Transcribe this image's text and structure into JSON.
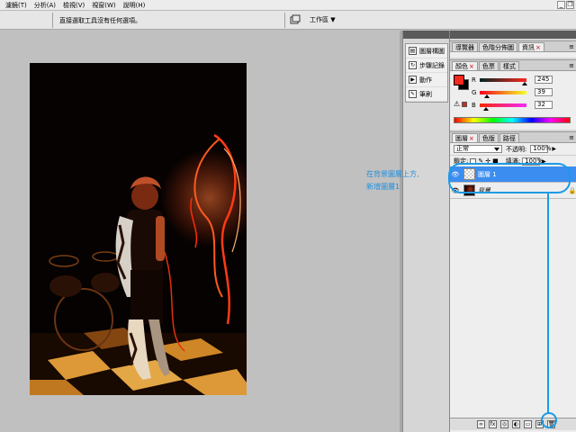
{
  "menubar": {
    "items": [
      "濾鏡(T)",
      "分析(A)",
      "檢視(V)",
      "視窗(W)",
      "說明(H)"
    ],
    "window_controls": [
      "_",
      "❐"
    ]
  },
  "optbar": {
    "message": "直接選取工具沒有任何選項。",
    "workspace_label": "工作區 ▼"
  },
  "mid_dock": {
    "items": [
      {
        "label": "圖層構圖",
        "icon": "layer-comps-icon"
      },
      {
        "label": "步驟記錄",
        "icon": "history-icon"
      },
      {
        "label": "動作",
        "icon": "actions-icon"
      },
      {
        "label": "筆刷",
        "icon": "brush-icon"
      }
    ]
  },
  "navigator_panel": {
    "tabs": [
      "導覽器",
      "色階分佈圖",
      "資訊"
    ]
  },
  "color_panel": {
    "tabs": [
      "顏色",
      "色票",
      "樣式"
    ],
    "foreground_color": "#f5271f",
    "background_color": "#000000",
    "channels": [
      {
        "label": "R",
        "value": "245",
        "fraction": 0.96
      },
      {
        "label": "G",
        "value": "39",
        "fraction": 0.15
      },
      {
        "label": "B",
        "value": "32",
        "fraction": 0.13
      }
    ]
  },
  "layers_panel": {
    "tabs": [
      "圖層",
      "色版",
      "路徑"
    ],
    "blend_mode": "正常",
    "opacity_label": "不透明:",
    "opacity_value": "100%",
    "lock_label": "鎖定:",
    "fill_label": "填滿:",
    "fill_value": "100%",
    "layers": [
      {
        "name": "圖層 1",
        "selected": true,
        "visible": true,
        "thumb": "checker",
        "locked": false
      },
      {
        "name": "背景",
        "selected": false,
        "visible": true,
        "thumb": "photo",
        "locked": true
      }
    ],
    "footer_buttons": [
      "fx",
      "◎",
      "◐",
      "▭",
      "⊞",
      "🗑"
    ]
  },
  "annotation": {
    "text": "在背景圖層上方,\n新增圖層1",
    "color": "#1b9be6"
  }
}
